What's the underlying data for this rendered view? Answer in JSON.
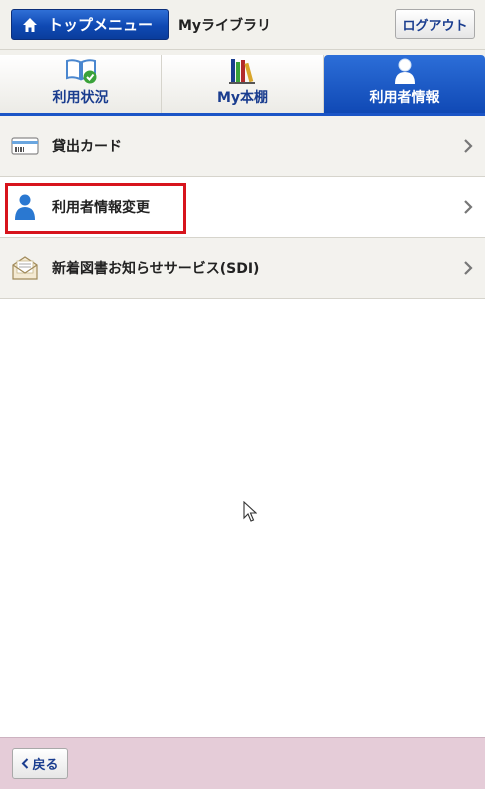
{
  "header": {
    "top_menu_label": "トップメニュー",
    "title": "Myライブラリ",
    "logout_label": "ログアウト",
    "home_icon": "home-icon"
  },
  "tabs": [
    {
      "label": "利用状況",
      "icon": "book-check-icon",
      "active": false
    },
    {
      "label": "My本棚",
      "icon": "bookshelf-icon",
      "active": false
    },
    {
      "label": "利用者情報",
      "icon": "user-icon",
      "active": true
    }
  ],
  "menu": {
    "items": [
      {
        "label": "貸出カード",
        "icon": "card-icon"
      },
      {
        "label": "利用者情報変更",
        "icon": "user-icon",
        "highlighted": true
      },
      {
        "label": "新着図書お知らせサービス(SDI)",
        "icon": "mail-icon"
      }
    ]
  },
  "footer": {
    "back_label": "戻る"
  },
  "colors": {
    "accent": "#1b55c6",
    "highlight": "#d7141c",
    "footer_bg": "#e5ccd8"
  }
}
